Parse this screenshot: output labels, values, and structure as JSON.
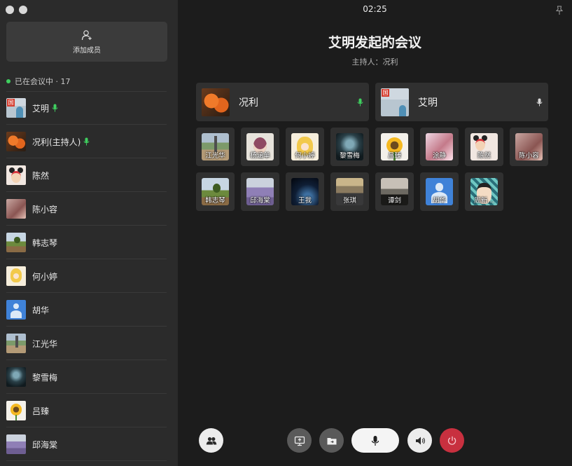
{
  "clock": "02:25",
  "meeting": {
    "title": "艾明发起的会议",
    "host_line": "主持人：况利"
  },
  "sidebar": {
    "add_member_label": "添加成员",
    "in_meeting_label": "已在会议中 · 17",
    "members": [
      {
        "name": "艾明",
        "avatar": "av-flag",
        "mic": true
      },
      {
        "name": "况利(主持人)",
        "avatar": "av-leaves",
        "mic": true
      },
      {
        "name": "陈然",
        "avatar": "av-minnie",
        "mic": false
      },
      {
        "name": "陈小容",
        "avatar": "av-girl",
        "mic": false
      },
      {
        "name": "韩志琴",
        "avatar": "av-field",
        "mic": false
      },
      {
        "name": "何小婷",
        "avatar": "av-cartoon",
        "mic": false
      },
      {
        "name": "胡华",
        "avatar": "av-default",
        "mic": false
      },
      {
        "name": "江光华",
        "avatar": "av-road",
        "mic": false
      },
      {
        "name": "黎雪梅",
        "avatar": "av-mist",
        "mic": false
      },
      {
        "name": "吕臻",
        "avatar": "av-sun",
        "mic": false
      },
      {
        "name": "邱海棠",
        "avatar": "av-lavender",
        "mic": false
      }
    ]
  },
  "speakers": [
    {
      "name": "况利",
      "avatar": "av-leaves",
      "mic_color": "#3fcf5f"
    },
    {
      "name": "艾明",
      "avatar": "av-flag",
      "mic_color": "#d8d8d8"
    }
  ],
  "tiles": [
    {
      "name": "江光华",
      "avatar": "av-road"
    },
    {
      "name": "杨涵单",
      "avatar": "av-yang"
    },
    {
      "name": "何小婷",
      "avatar": "av-cartoon"
    },
    {
      "name": "黎雪梅",
      "avatar": "av-mist"
    },
    {
      "name": "吕臻",
      "avatar": "av-sun"
    },
    {
      "name": "涂静",
      "avatar": "av-tujing"
    },
    {
      "name": "陈然",
      "avatar": "av-minnie"
    },
    {
      "name": "陈小容",
      "avatar": "av-girl"
    },
    {
      "name": "韩志琴",
      "avatar": "av-field"
    },
    {
      "name": "邱海棠",
      "avatar": "av-lavender"
    },
    {
      "name": "王我",
      "avatar": "av-night"
    },
    {
      "name": "张琪",
      "avatar": "av-sea"
    },
    {
      "name": "谭剑",
      "avatar": "av-dusk"
    },
    {
      "name": "胡华",
      "avatar": "av-default"
    },
    {
      "name": "周新…",
      "avatar": "av-zhou"
    }
  ],
  "controls": {
    "members": "members-icon",
    "screen_share": "screen-share-icon",
    "file_share": "file-share-icon",
    "microphone": "microphone-icon",
    "speaker": "speaker-icon",
    "hangup": "power-icon"
  },
  "colors": {
    "sidebar_bg": "#2b2b2b",
    "main_bg": "#1c1c1c",
    "card_bg": "#303030",
    "mic_active": "#3fcf5f",
    "hangup": "#c8303f",
    "control_gray": "#5a5a5a"
  }
}
